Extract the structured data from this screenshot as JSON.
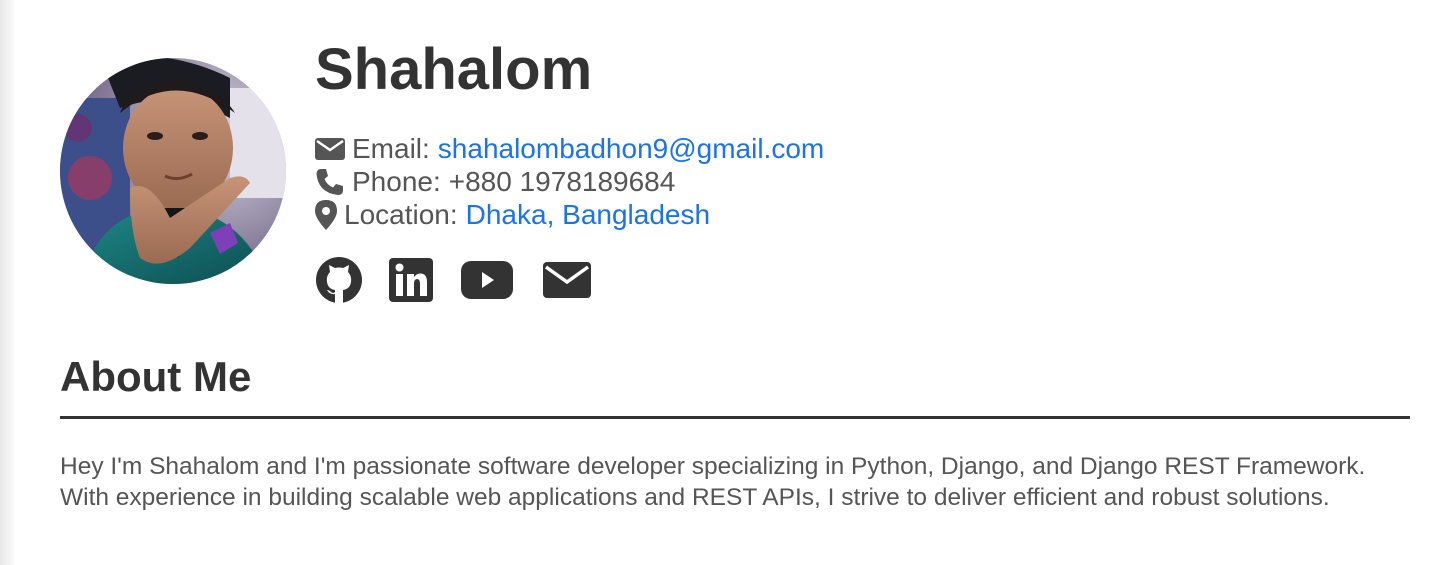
{
  "profile": {
    "name": "Shahalom",
    "avatar_alt": "Profile photo",
    "contact": {
      "email_label": "Email:",
      "email_value": "shahalombadhon9@gmail.com",
      "phone_label": "Phone:",
      "phone_value": "+880 1978189684",
      "location_label": "Location:",
      "location_value": "Dhaka, Bangladesh"
    },
    "socials": [
      {
        "icon": "github-icon"
      },
      {
        "icon": "linkedin-icon"
      },
      {
        "icon": "youtube-icon"
      },
      {
        "icon": "envelope-icon"
      }
    ]
  },
  "about": {
    "title": "About Me",
    "text": "Hey I'm Shahalom and I'm passionate software developer specializing in Python, Django, and Django REST Framework. With experience in building scalable web applications and REST APIs, I strive to deliver efficient and robust solutions."
  },
  "colors": {
    "text_dark": "#333333",
    "text_body": "#555555",
    "link": "#1a73e8"
  }
}
